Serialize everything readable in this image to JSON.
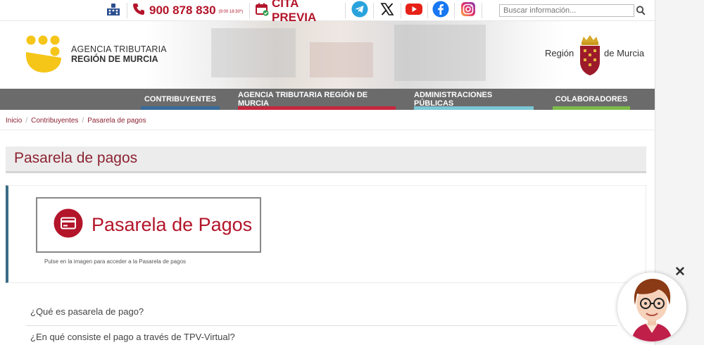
{
  "topbar": {
    "phone_number": "900 878 830",
    "phone_hours": "(9:00 18:30*)",
    "cita_label": "CITA PREVIA",
    "search_placeholder": "Buscar información..."
  },
  "header": {
    "agency_line1": "AGENCIA TRIBUTARIA",
    "agency_line2": "REGIÓN DE MURCIA",
    "region_part1": "Región",
    "region_part2": "de Murcia"
  },
  "nav": {
    "items": [
      {
        "label": "CONTRIBUYENTES",
        "accent": "#3a6b9a"
      },
      {
        "label": "AGENCIA TRIBUTARIA REGIÓN DE MURCIA",
        "accent": "#c4273d"
      },
      {
        "label": "ADMINISTRACIONES PÚBLICAS",
        "accent": "#7ac7d6"
      },
      {
        "label": "COLABORADORES",
        "accent": "#7dbb4a"
      }
    ]
  },
  "breadcrumb": {
    "items": [
      "Inicio",
      "Contribuyentes",
      "Pasarela de pagos"
    ]
  },
  "page": {
    "title": "Pasarela de pagos",
    "pay_image_label": "Pasarela de Pagos",
    "caption": "Pulse en la imagen para acceder a la Pasarela de pagos"
  },
  "faq": {
    "items": [
      "¿Qué es pasarela de pago?",
      "¿En qué consiste el pago a través de TPV-Virtual?"
    ]
  },
  "chat": {
    "close_glyph": "✕"
  },
  "colors": {
    "brand_red": "#b3152a",
    "title_red": "#8c2232",
    "nav_gray": "#6b6b6b",
    "logo_yellow": "#f5c518"
  },
  "icons": [
    "braille-icon",
    "phone-icon",
    "calendar-check-icon",
    "telegram-icon",
    "x-twitter-icon",
    "youtube-icon",
    "facebook-icon",
    "instagram-icon",
    "search-icon",
    "credit-card-icon",
    "close-icon"
  ]
}
